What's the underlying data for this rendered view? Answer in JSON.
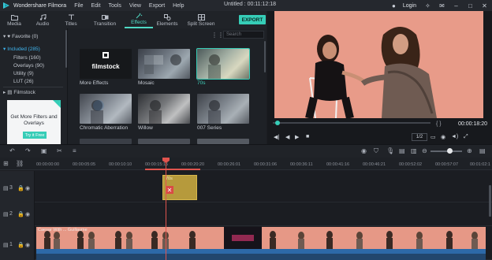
{
  "app": {
    "name": "Wondershare Filmora",
    "menu": [
      "File",
      "Edit",
      "Tools",
      "View",
      "Export",
      "Help"
    ],
    "doc_title": "Untitled : 00:11:12:18",
    "login": "Login"
  },
  "tabs": [
    {
      "label": "Media",
      "icon": "folder-icon"
    },
    {
      "label": "Audio",
      "icon": "music-note-icon"
    },
    {
      "label": "Titles",
      "icon": "text-icon"
    },
    {
      "label": "Transition",
      "icon": "transition-icon"
    },
    {
      "label": "Effects",
      "icon": "effects-icon",
      "active": true
    },
    {
      "label": "Elements",
      "icon": "elements-icon"
    },
    {
      "label": "Split Screen",
      "icon": "split-screen-icon"
    }
  ],
  "export_label": "EXPORT",
  "categories": {
    "favorite": "Favorite (0)",
    "included": "Included (285)",
    "items": [
      "Filters (160)",
      "Overlays (90)",
      "Utility (9)",
      "LUT (26)"
    ],
    "filmstock": "Filmstock"
  },
  "promo": {
    "text": "Get More Filters and Overlays",
    "button": "Try it Free"
  },
  "search_placeholder": "Search",
  "effects": [
    {
      "label": "More Effects",
      "thumb_text": "filmstock"
    },
    {
      "label": "Mosaic"
    },
    {
      "label": "70s",
      "selected": true
    },
    {
      "label": "Chromatic Aberration"
    },
    {
      "label": "Willow"
    },
    {
      "label": "007 Series"
    }
  ],
  "preview": {
    "timecode": "00:00:18:20",
    "ratio": "1/2",
    "brackets": "{   }"
  },
  "ruler": [
    "00:00:00:00",
    "00:00:05:05",
    "00:00:10:10",
    "00:00:15:15",
    "00:00:20:20",
    "00:00:26:01",
    "00:00:31:06",
    "00:00:36:11",
    "00:00:41:16",
    "00:00:46:21",
    "00:00:52:02",
    "00:00:57:07",
    "00:01:02:1"
  ],
  "tracks": [
    {
      "num": "3"
    },
    {
      "num": "2"
    },
    {
      "num": "1"
    }
  ],
  "clips": {
    "effect_label": "70s",
    "video_label": "Caesar With ... Guillaume"
  },
  "colors": {
    "accent": "#36cdb7",
    "playhead": "#e0544e",
    "selection_blue": "#3fb6f0"
  }
}
